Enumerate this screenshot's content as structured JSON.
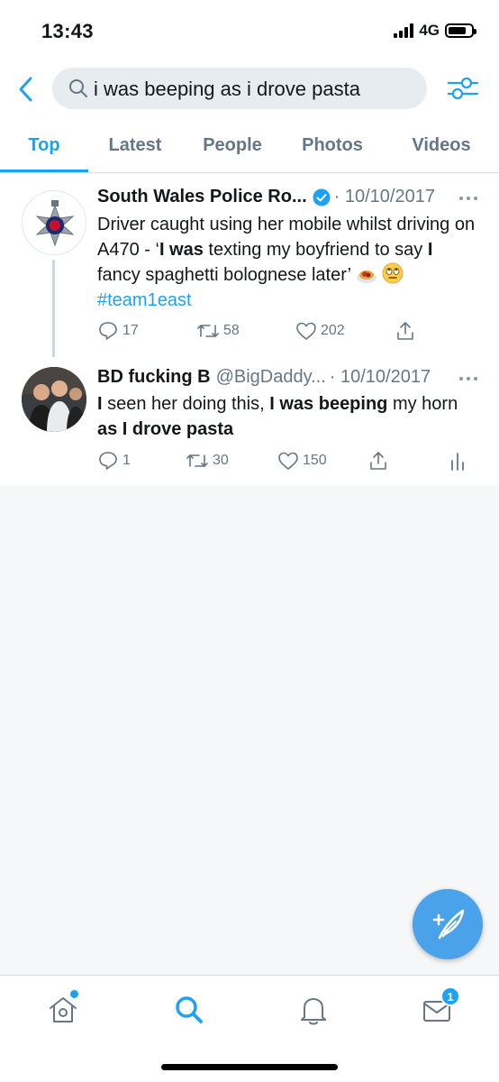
{
  "status": {
    "time": "13:43",
    "network": "4G"
  },
  "search": {
    "query": "i was beeping as i drove pasta"
  },
  "tabs": [
    "Top",
    "Latest",
    "People",
    "Photos",
    "Videos"
  ],
  "tweets": [
    {
      "name": "South Wales Police Ro...",
      "date": "· 10/10/2017",
      "body": {
        "p1": "Driver caught using her mobile whilst driving on A470 - ‘",
        "b1": "I was",
        "p2": " texting my boyfriend to say ",
        "b2": "I",
        "p3": " fancy spaghetti bolognese later’ ",
        "hashtag": "#team1east"
      },
      "replies": "17",
      "retweets": "58",
      "likes": "202"
    },
    {
      "name": "BD fucking B",
      "handle": "@BigDaddy...",
      "date": "· 10/10/2017",
      "body": {
        "b1": "I",
        "p1": " seen her doing this, ",
        "b2": "I was beeping",
        "p2": " my horn ",
        "b3": "as I drove pasta"
      },
      "replies": "1",
      "retweets": "30",
      "likes": "150"
    }
  ],
  "nav": {
    "messages_badge": "1"
  },
  "colors": {
    "accent": "#1da1f2",
    "muted": "#657786",
    "background": "#f5f7f9"
  }
}
